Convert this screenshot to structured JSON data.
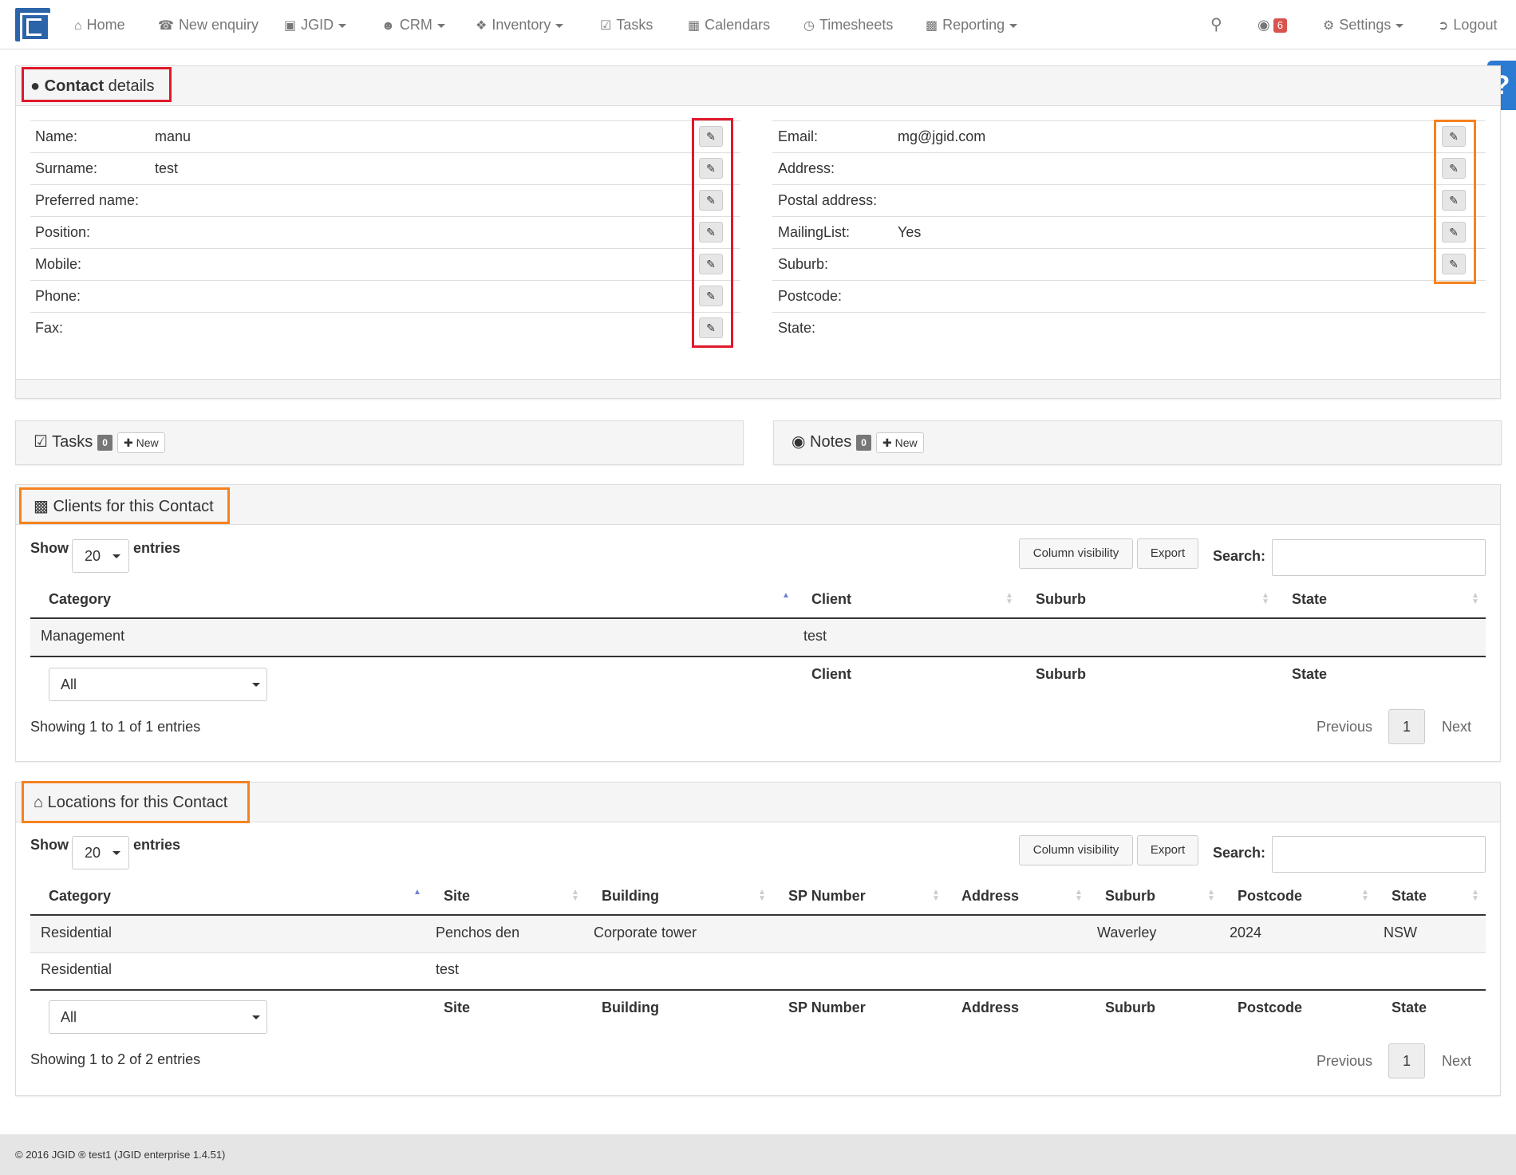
{
  "nav": {
    "items": [
      {
        "icon": "home-icon",
        "label": "Home"
      },
      {
        "icon": "phone-icon",
        "label": "New enquiry"
      },
      {
        "icon": "jgid-icon",
        "label": "JGID"
      },
      {
        "icon": "users-icon",
        "label": "CRM"
      },
      {
        "icon": "cubes-icon",
        "label": "Inventory"
      },
      {
        "icon": "check-square-icon",
        "label": "Tasks"
      },
      {
        "icon": "calendar-icon",
        "label": "Calendars"
      },
      {
        "icon": "clock-icon",
        "label": "Timesheets"
      },
      {
        "icon": "bar-chart-icon",
        "label": "Reporting"
      }
    ],
    "notifications_count": "6",
    "settings_label": "Settings",
    "logout_label": "Logout"
  },
  "help_label": "?",
  "contact": {
    "title_bold": "Contact",
    "title_rest": " details",
    "left_fields": [
      {
        "label": "Name:",
        "value": "manu"
      },
      {
        "label": "Surname:",
        "value": "test"
      },
      {
        "label": "Preferred name:",
        "value": ""
      },
      {
        "label": "Position:",
        "value": ""
      },
      {
        "label": "Mobile:",
        "value": ""
      },
      {
        "label": "Phone:",
        "value": ""
      },
      {
        "label": "Fax:",
        "value": ""
      }
    ],
    "right_fields": [
      {
        "label": "Email:",
        "value": "mg@jgid.com"
      },
      {
        "label": "Address:",
        "value": ""
      },
      {
        "label": "Postal address:",
        "value": ""
      },
      {
        "label": "MailingList:",
        "value": "Yes"
      },
      {
        "label": "Suburb:",
        "value": ""
      },
      {
        "label": "Postcode:",
        "value": ""
      },
      {
        "label": "State:",
        "value": ""
      }
    ]
  },
  "tasks": {
    "title": "Tasks",
    "count": "0",
    "new_label": "New"
  },
  "notes": {
    "title": "Notes",
    "count": "0",
    "new_label": "New"
  },
  "clients": {
    "title": "Clients for this Contact",
    "show_label": "Show",
    "entries_label": "entries",
    "page_size": "20",
    "column_visibility_label": "Column visibility",
    "export_label": "Export",
    "search_label": "Search:",
    "columns": [
      "Category",
      "Client",
      "Suburb",
      "State"
    ],
    "rows": [
      [
        "Management",
        "test",
        "",
        ""
      ]
    ],
    "filter_value": "All",
    "footer_columns": [
      "Client",
      "Suburb",
      "State"
    ],
    "info": "Showing 1 to 1 of 1 entries",
    "previous_label": "Previous",
    "page": "1",
    "next_label": "Next"
  },
  "locations": {
    "title": "Locations for this Contact",
    "show_label": "Show",
    "entries_label": "entries",
    "page_size": "20",
    "column_visibility_label": "Column visibility",
    "export_label": "Export",
    "search_label": "Search:",
    "columns": [
      "Category",
      "Site",
      "Building",
      "SP Number",
      "Address",
      "Suburb",
      "Postcode",
      "State"
    ],
    "rows": [
      [
        "Residential",
        "Penchos den",
        "Corporate tower",
        "",
        "",
        "Waverley",
        "2024",
        "NSW"
      ],
      [
        "Residential",
        "test",
        "",
        "",
        "",
        "",
        "",
        ""
      ]
    ],
    "filter_value": "All",
    "footer_columns": [
      "Site",
      "Building",
      "SP Number",
      "Address",
      "Suburb",
      "Postcode",
      "State"
    ],
    "info": "Showing 1 to 2 of 2 entries",
    "previous_label": "Previous",
    "page": "1",
    "next_label": "Next"
  },
  "footer": {
    "text": "© 2016 JGID ® test1 (JGID enterprise 1.4.51)"
  },
  "colors": {
    "brand": "#2b64a8",
    "highlight_red": "#e0192b",
    "highlight_orange": "#f58220",
    "help_tab": "#2b7bd3",
    "badge": "#d9534f"
  }
}
